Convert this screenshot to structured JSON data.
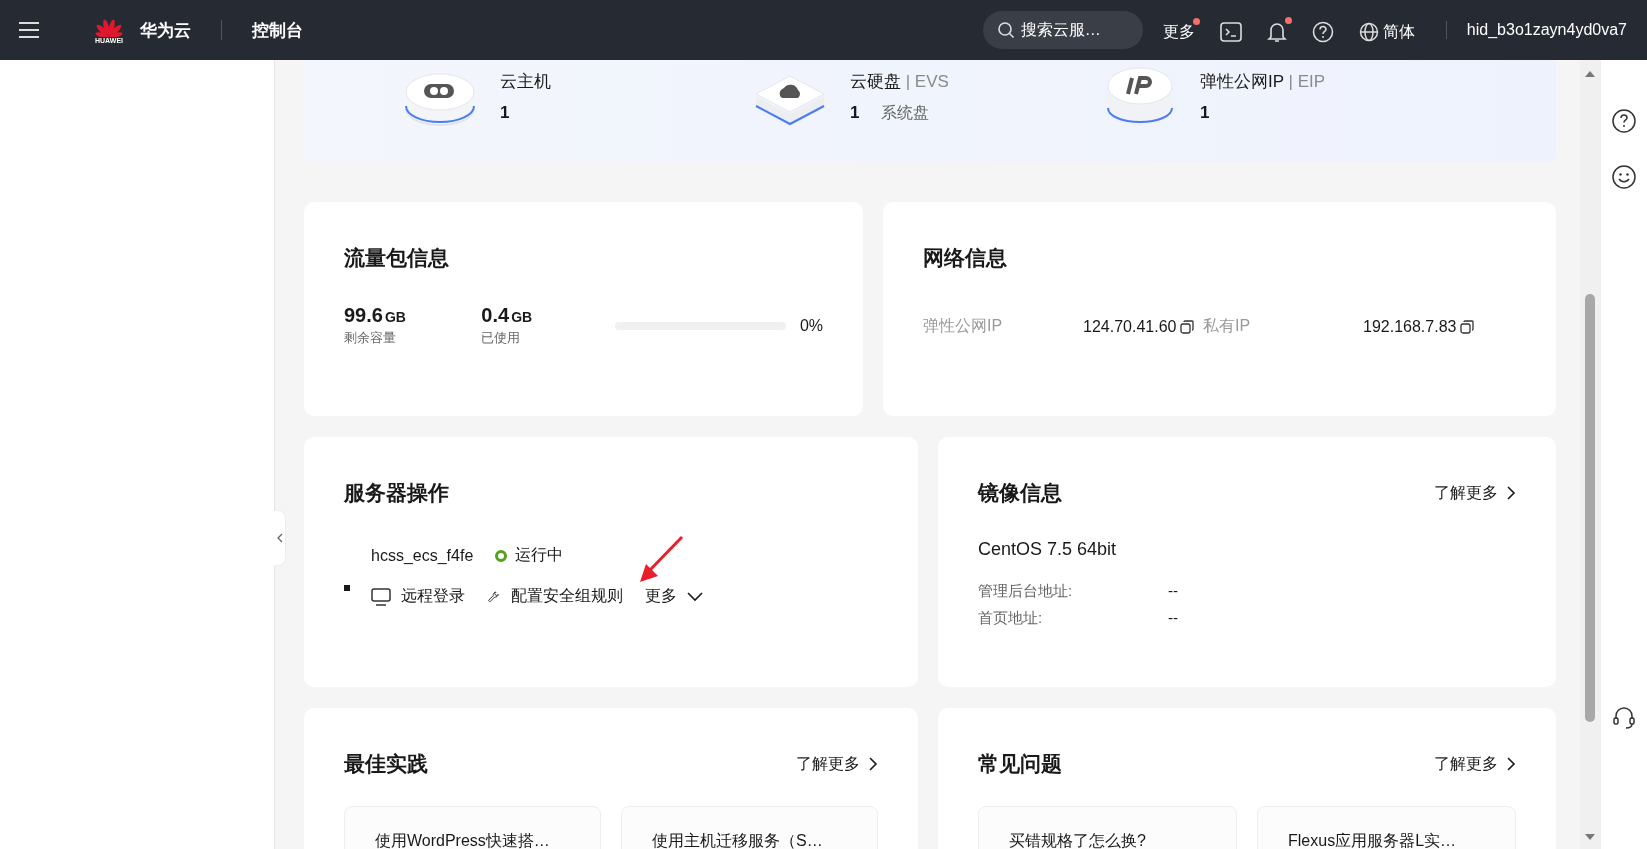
{
  "header": {
    "brand": "华为云",
    "logo_caption": "HUAWEI",
    "console": "控制台",
    "search": {
      "placeholder": "搜索云服…"
    },
    "more": {
      "label": "更多",
      "badge": true
    },
    "notifications_badge": true,
    "language": "简体",
    "account": "hid_b3o1zayn4yd0va7"
  },
  "resources": [
    {
      "kind": "server",
      "name": "云主机",
      "count": "1"
    },
    {
      "kind": "disk",
      "name": "云硬盘",
      "suffix": "| EVS",
      "count": "1",
      "note": "系统盘"
    },
    {
      "kind": "ip",
      "name": "弹性公网IP",
      "suffix": "| EIP",
      "count": "1"
    }
  ],
  "traffic": {
    "title": "流量包信息",
    "stats": [
      {
        "value": "99.6",
        "unit": "GB",
        "label": "剩余容量"
      },
      {
        "value": "0.4",
        "unit": "GB",
        "label": "已使用"
      }
    ],
    "usage": {
      "level": 0,
      "reading": "0%"
    }
  },
  "network": {
    "title": "网络信息",
    "fields": [
      {
        "label": "弹性公网IP",
        "value": "124.70.41.60"
      },
      {
        "label": "私有IP",
        "value": "192.168.7.83"
      }
    ]
  },
  "server_ops": {
    "title": "服务器操作",
    "server_name": "hcss_ecs_f4fe",
    "status": {
      "label": "运行中",
      "color": "#52a31b"
    },
    "actions": [
      {
        "kind": "monitor",
        "label": "远程登录"
      },
      {
        "kind": "wrench",
        "label": "配置安全组规则"
      },
      {
        "kind": "dropdown",
        "label": "更多"
      }
    ]
  },
  "image": {
    "title": "镜像信息",
    "link": "了解更多",
    "os": "CentOS 7.5 64bit",
    "fields": [
      {
        "label": "管理后台地址:",
        "value": "--"
      },
      {
        "label": "首页地址:",
        "value": "--"
      }
    ]
  },
  "best_practice": {
    "title": "最佳实践",
    "link": "了解更多",
    "items": [
      "使用WordPress快速搭…",
      "使用主机迁移服务（S…"
    ]
  },
  "faq": {
    "title": "常见问题",
    "link": "了解更多",
    "items": [
      "买错规格了怎么换?",
      "Flexus应用服务器L实…"
    ]
  }
}
